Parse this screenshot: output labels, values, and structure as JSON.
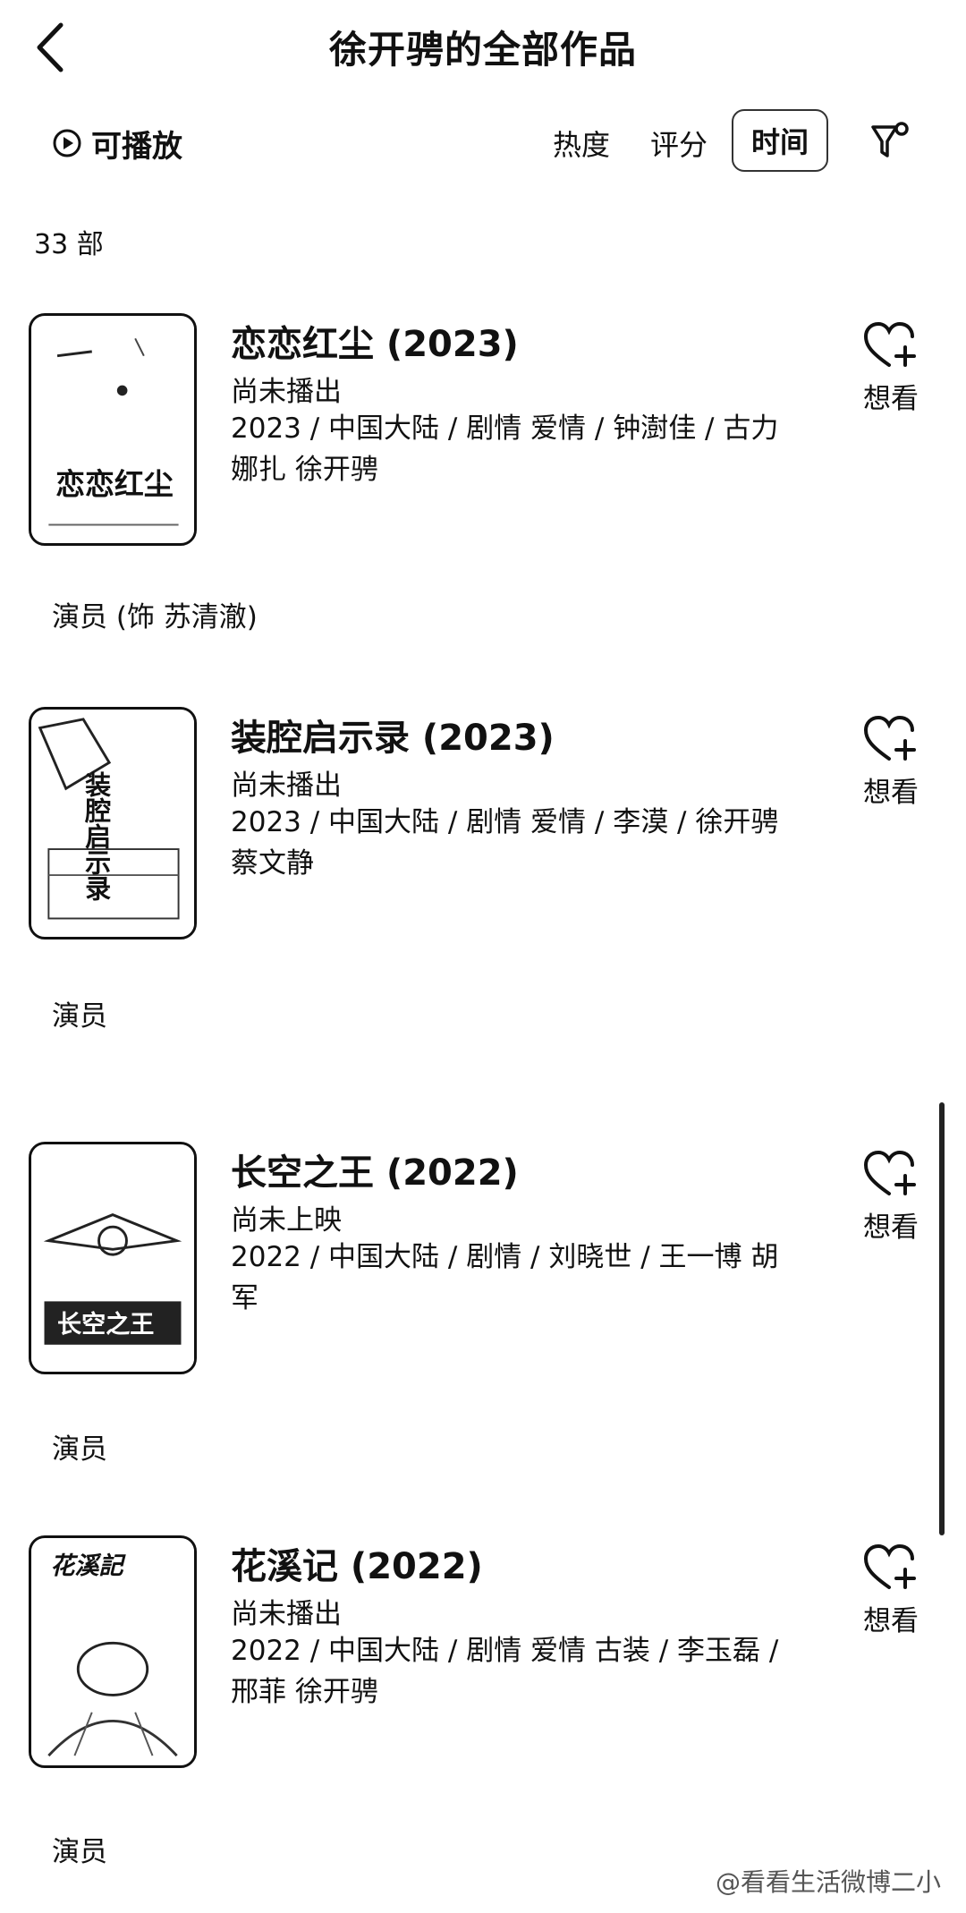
{
  "header": {
    "title": "徐开骋的全部作品",
    "back_icon": "chevron-left-icon"
  },
  "toolbar": {
    "playable_label": "可播放",
    "sort_options": [
      {
        "label": "热度",
        "active": false
      },
      {
        "label": "评分",
        "active": false
      },
      {
        "label": "时间",
        "active": true
      }
    ],
    "filter_icon": "filter-icon"
  },
  "count_text": "33 部",
  "movies": [
    {
      "title": "恋恋红尘 (2023)",
      "status": "尚未播出",
      "meta": "2023 / 中国大陆 / 剧情 爱情 / 钟澍佳 / 古力娜扎 徐开骋",
      "want_label": "想看",
      "role": "演员 (饰 苏清澈)",
      "poster_text": "恋恋红尘"
    },
    {
      "title": "装腔启示录 (2023)",
      "status": "尚未播出",
      "meta": "2023 / 中国大陆 / 剧情 爱情 / 李漠 / 徐开骋 蔡文静",
      "want_label": "想看",
      "role": "演员",
      "poster_text": "装腔启示录"
    },
    {
      "title": "长空之王 (2022)",
      "status": "尚未上映",
      "meta": "2022 / 中国大陆 / 剧情 / 刘晓世 / 王一博 胡军",
      "want_label": "想看",
      "role": "演员",
      "poster_text": "长空之王"
    },
    {
      "title": "花溪记 (2022)",
      "status": "尚未播出",
      "meta": "2022 / 中国大陆 / 剧情 爱情 古装 / 李玉磊 / 邢菲 徐开骋",
      "want_label": "想看",
      "role": "演员",
      "poster_text": "花溪記"
    }
  ],
  "watermark": "@看看生活微博二小"
}
